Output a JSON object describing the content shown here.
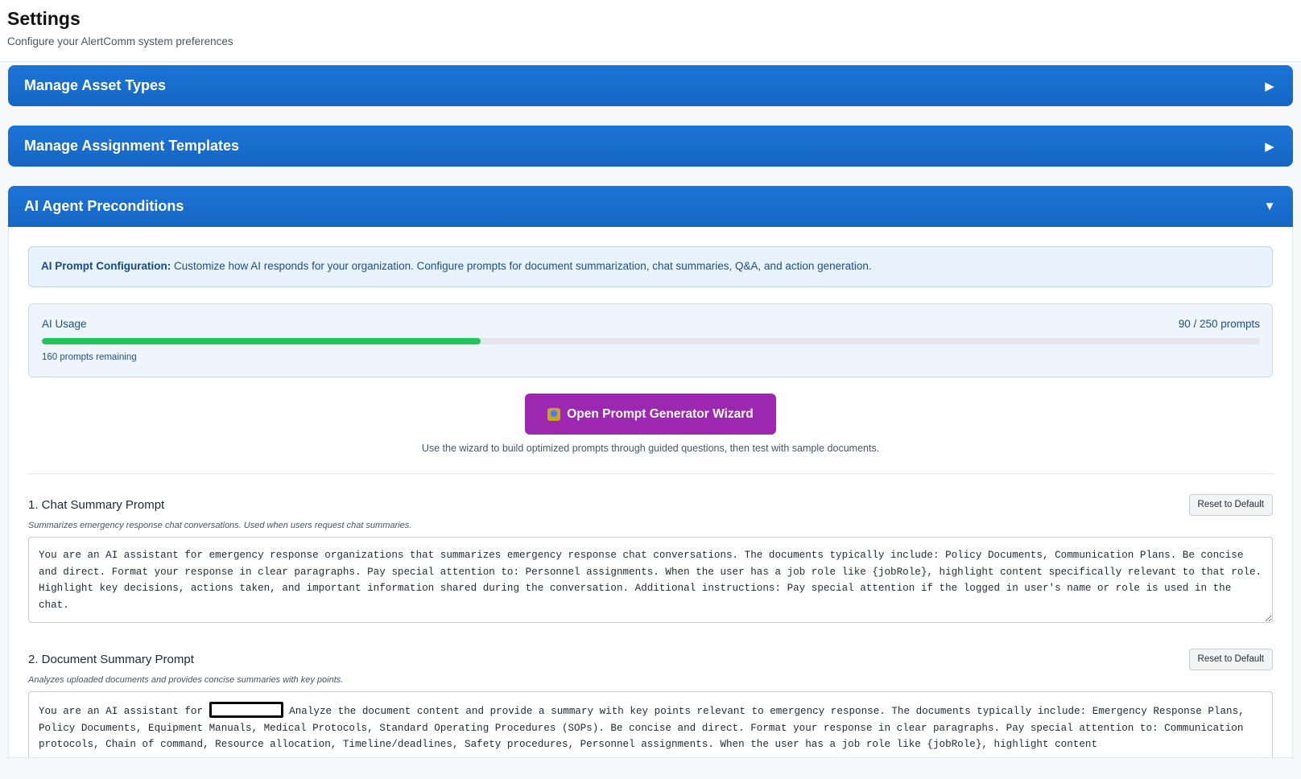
{
  "header": {
    "title": "Settings",
    "subtitle": "Configure your AlertComm system preferences"
  },
  "sections": [
    {
      "title": "Manage Asset Types",
      "state": "collapsed",
      "chevron": "▶"
    },
    {
      "title": "Manage Assignment Templates",
      "state": "collapsed",
      "chevron": "▶"
    },
    {
      "title": "AI Agent Preconditions",
      "state": "expanded",
      "chevron": "▼"
    }
  ],
  "ai": {
    "info_label": "AI Prompt Configuration:",
    "info_text": " Customize how AI responds for your organization. Configure prompts for document summarization, chat summaries, Q&A, and action generation.",
    "usage": {
      "label": "AI Usage",
      "count_text": "90 / 250 prompts",
      "used": 90,
      "limit": 250,
      "remaining_text": "160 prompts remaining",
      "bar_color": "#22c55e"
    },
    "wizard": {
      "button_label": "Open Prompt Generator Wizard",
      "icon": "wizard-icon",
      "hint": "Use the wizard to build optimized prompts through guided questions, then test with sample documents."
    },
    "prompts": [
      {
        "title": "1. Chat Summary Prompt",
        "reset_label": "Reset to Default",
        "description": "Summarizes emergency response chat conversations. Used when users request chat summaries.",
        "text": "You are an AI assistant for emergency response organizations that summarizes emergency response chat conversations. The documents typically include: Policy Documents, Communication Plans. Be concise and direct. Format your response in clear paragraphs. Pay special attention to: Personnel assignments. When the user has a job role like {jobRole}, highlight content specifically relevant to that role. Highlight key decisions, actions taken, and important information shared during the conversation. Additional instructions: Pay special attention if the logged in user's name or role is used in the chat."
      },
      {
        "title": "2. Document Summary Prompt",
        "reset_label": "Reset to Default",
        "description": "Analyzes uploaded documents and provides concise summaries with key points.",
        "text_before": "You are an AI assistant for ",
        "text_after": " Analyze the document content and provide a summary with key points relevant to emergency response. The documents typically include: Emergency Response Plans, Policy Documents, Equipment Manuals, Medical Protocols, Standard Operating Procedures (SOPs). Be concise and direct. Format your response in clear paragraphs. Pay special attention to: Communication protocols, Chain of command, Resource allocation, Timeline/deadlines, Safety procedures, Personnel assignments. When the user has a job role like {jobRole}, highlight content"
      }
    ]
  },
  "colors": {
    "section_header": "#1a6fd0",
    "wizard_button": "#9c27b0",
    "info_bg": "#e8f2fc"
  }
}
